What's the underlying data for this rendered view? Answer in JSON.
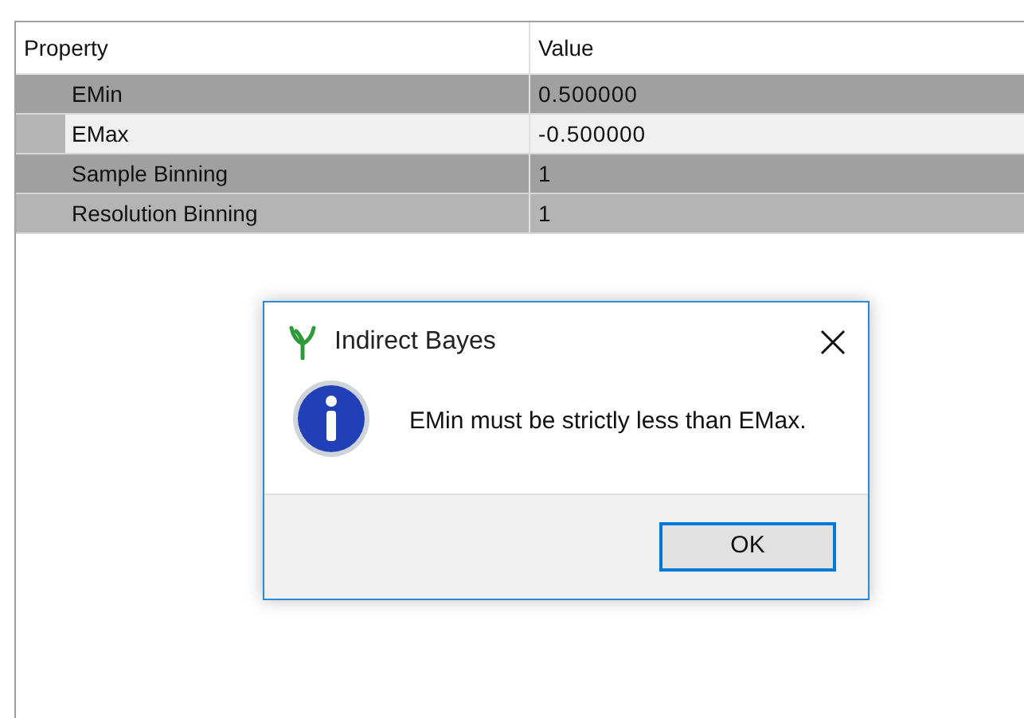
{
  "table": {
    "columns": [
      "Property",
      "Value"
    ],
    "rows": [
      {
        "property": "EMin",
        "value": "0.500000",
        "selected": false
      },
      {
        "property": "EMax",
        "value": "-0.500000",
        "selected": true
      },
      {
        "property": "Sample Binning",
        "value": "1",
        "selected": false
      },
      {
        "property": "Resolution Binning",
        "value": "1",
        "selected": false
      }
    ]
  },
  "dialog": {
    "title": "Indirect Bayes",
    "message": "EMin must be strictly less than EMax.",
    "buttons": [
      "OK"
    ]
  }
}
